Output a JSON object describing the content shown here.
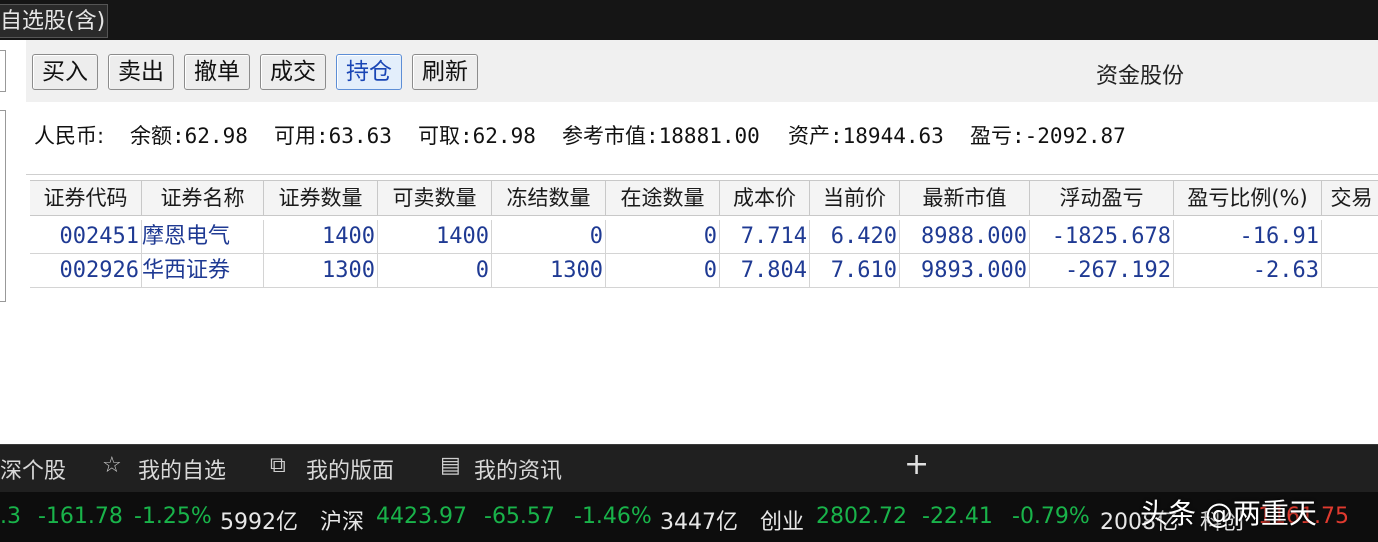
{
  "window": {
    "tab_title": "自选股(含)"
  },
  "toolbar": {
    "buttons": [
      "买入",
      "卖出",
      "撤单",
      "成交",
      "持仓",
      "刷新"
    ],
    "active": "持仓",
    "panel_title": "资金股份"
  },
  "account": {
    "currency_label": "人民币:",
    "balance": "余额:62.98",
    "available": "可用:63.63",
    "withdrawable": "可取:62.98",
    "market_value": "参考市值:18881.00",
    "assets": "资产:18944.63",
    "pnl": "盈亏:-2092.87"
  },
  "table": {
    "headers": [
      "证券代码",
      "证券名称",
      "证券数量",
      "可卖数量",
      "冻结数量",
      "在途数量",
      "成本价",
      "当前价",
      "最新市值",
      "浮动盈亏",
      "盈亏比例(%)",
      "交易"
    ],
    "rows": [
      [
        "002451",
        "摩恩电气",
        "1400",
        "1400",
        "0",
        "0",
        "7.714",
        "6.420",
        "8988.000",
        "-1825.678",
        "-16.91",
        ""
      ],
      [
        "002926",
        "华西证券",
        "1300",
        "0",
        "1300",
        "0",
        "7.804",
        "7.610",
        "9893.000",
        "-267.192",
        "-2.63",
        ""
      ]
    ]
  },
  "nav": {
    "items": [
      "深个股",
      "我的自选",
      "我的版面",
      "我的资讯"
    ],
    "plus": "+"
  },
  "ticker": {
    "t1": ".3",
    "t2": "-161.78",
    "t3": "-1.25%",
    "t4": "5992亿",
    "t5": "沪深",
    "t6": "4423.97",
    "t7": "-65.57",
    "t8": "-1.46%",
    "t9": "3447亿",
    "t10": "创业",
    "t11": "2802.72",
    "t12": "-22.41",
    "t13": "-0.79%",
    "t14": "2008亿",
    "t15": "科创",
    "t16": "1161.75"
  },
  "watermark": "头条 @两重天",
  "colors": {
    "accent_active": "#1a46b5",
    "up_red": "#e03a2f",
    "down_green": "#19b34a",
    "grid_text": "#1f3a93"
  }
}
